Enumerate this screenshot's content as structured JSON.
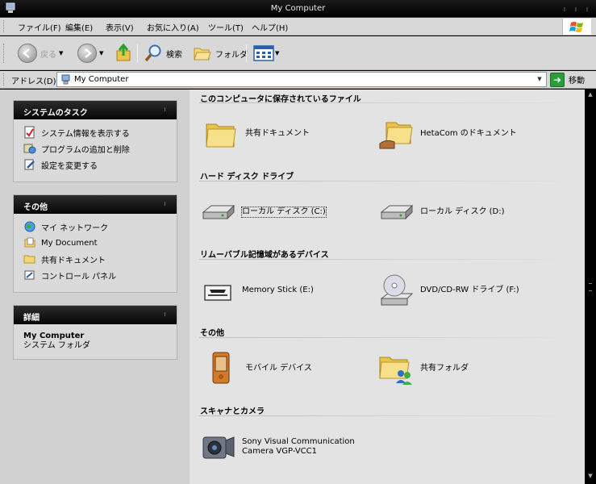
{
  "window": {
    "title": "My Computer"
  },
  "menu": [
    "ファイル(F)",
    "編集(E)",
    "表示(V)",
    "お気に入り(A)",
    "ツール(T)",
    "ヘルプ(H)"
  ],
  "toolbar": {
    "back_label": "戻る",
    "search_label": "検索",
    "folders_label": "フォルダ"
  },
  "address": {
    "label": "アドレス(D)",
    "value": "My Computer",
    "go_label": "移動"
  },
  "sidebar": {
    "tasks": {
      "title": "システムのタスク",
      "items": [
        "システム情報を表示する",
        "プログラムの追加と削除",
        "設定を変更する"
      ]
    },
    "other": {
      "title": "その他",
      "items": [
        "マイ ネットワーク",
        "My Document",
        "共有ドキュメント",
        "コントロール パネル"
      ]
    },
    "details": {
      "title": "詳細",
      "name": "My Computer",
      "type": "システム フォルダ"
    }
  },
  "groups": [
    {
      "title": "このコンピュータに保存されているファイル",
      "items": [
        "共有ドキュメント",
        "HetaCom のドキュメント"
      ]
    },
    {
      "title": "ハード ディスク ドライブ",
      "items": [
        "ローカル ディスク (C:)",
        "ローカル ディスク (D:)"
      ]
    },
    {
      "title": "リムーバブル記憶域があるデバイス",
      "items": [
        "Memory Stick (E:)",
        "DVD/CD-RW ドライブ (F:)"
      ]
    },
    {
      "title": "その他",
      "items": [
        "モバイル デバイス",
        "共有フォルダ"
      ]
    },
    {
      "title": "スキャナとカメラ",
      "items": [
        "Sony Visual Communication",
        "Camera VGP-VCC1"
      ]
    }
  ],
  "colors": {
    "titlebar": "#000000",
    "panel_header": "#0a0a0a",
    "go_button": "#2d9d3a"
  }
}
